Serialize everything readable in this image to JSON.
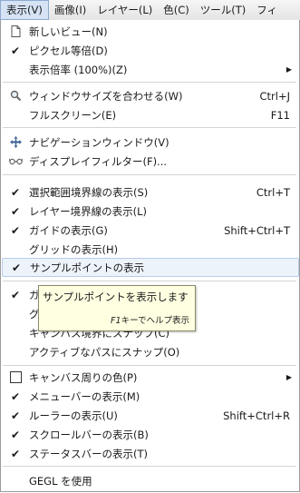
{
  "menubar": {
    "items": [
      "表示(V)",
      "画像(I)",
      "レイヤー(L)",
      "色(C)",
      "ツール(T)",
      "フィ"
    ]
  },
  "menu": {
    "items": [
      {
        "label": "新しいビュー(N)",
        "icon": "document-icon"
      },
      {
        "label": "ピクセル等倍(D)",
        "check": true
      },
      {
        "label": "表示倍率 (100%)(Z)",
        "submenu": true
      },
      {
        "label": "ウィンドウサイズを合わせる(W)",
        "accel": "Ctrl+J",
        "icon": "zoom-icon"
      },
      {
        "label": "フルスクリーン(E)",
        "accel": "F11"
      },
      {
        "label": "ナビゲーションウィンドウ(V)",
        "icon": "navigate-icon"
      },
      {
        "label": "ディスプレイフィルター(F)...",
        "icon": "glasses-icon"
      },
      {
        "label": "選択範囲境界線の表示(S)",
        "accel": "Ctrl+T",
        "check": true
      },
      {
        "label": "レイヤー境界線の表示(L)",
        "check": true
      },
      {
        "label": "ガイドの表示(G)",
        "accel": "Shift+Ctrl+T",
        "check": true
      },
      {
        "label": "グリッドの表示(H)"
      },
      {
        "label": "サンプルポイントの表示",
        "check": true
      },
      {
        "label": "ガ",
        "check": true
      },
      {
        "label": "グ"
      },
      {
        "label": "キャンバス境界にスナップ(C)"
      },
      {
        "label": "アクティブなパスにスナップ(O)"
      },
      {
        "label": "キャンバス周りの色(P)",
        "submenu": true,
        "box": true
      },
      {
        "label": "メニューバーの表示(M)",
        "check": true
      },
      {
        "label": "ルーラーの表示(U)",
        "accel": "Shift+Ctrl+R",
        "check": true
      },
      {
        "label": "スクロールバーの表示(B)",
        "check": true
      },
      {
        "label": "ステータスバーの表示(T)",
        "check": true
      },
      {
        "label": "GEGL を使用"
      }
    ]
  },
  "tooltip": {
    "text": "サンプルポイントを表示します",
    "help_key": "F1",
    "help_text": "キーでヘルプ表示"
  }
}
